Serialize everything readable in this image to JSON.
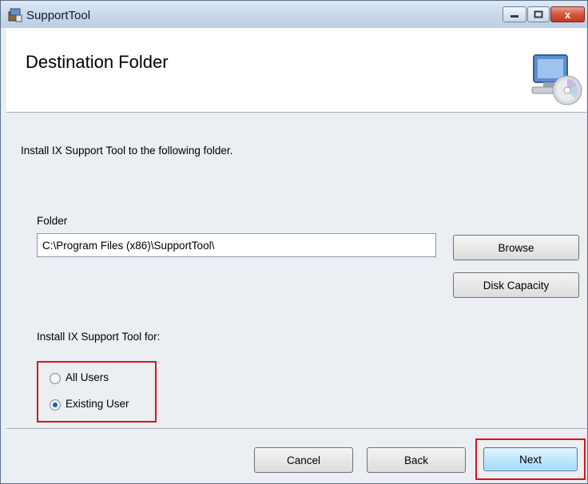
{
  "window": {
    "title": "SupportTool",
    "close_glyph": "x"
  },
  "header": {
    "title": "Destination Folder",
    "graphic": "computer-disc-icon"
  },
  "content": {
    "intro": "Install IX Support Tool to the following folder.",
    "folder_label": "Folder",
    "folder_value": "C:\\Program Files (x86)\\SupportTool\\",
    "browse_label": "Browse",
    "disk_capacity_label": "Disk Capacity",
    "install_for_label": "Install IX Support Tool for:",
    "radio_options": [
      {
        "label": "All Users",
        "checked": false
      },
      {
        "label": "Existing User",
        "checked": true
      }
    ]
  },
  "footer": {
    "cancel_label": "Cancel",
    "back_label": "Back",
    "next_label": "Next"
  },
  "colors": {
    "highlight": "#d9141b",
    "accent": "#1d5fb5"
  }
}
